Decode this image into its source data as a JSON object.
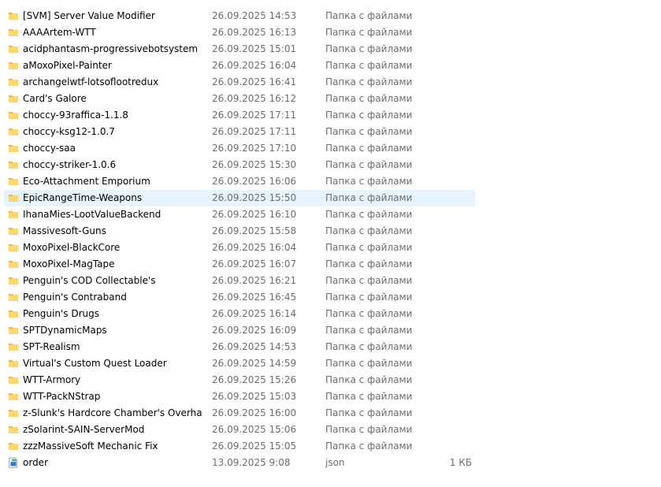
{
  "colors": {
    "selected_row_bg": "#e5f3ff",
    "secondary_text": "#6d6d6d",
    "folder_fill": "#ffd86b",
    "folder_dark": "#e8b13a"
  },
  "rows": [
    {
      "name": "[SVM] Server Value Modifier",
      "date": "26.09.2025 14:53",
      "type": "Папка с файлами",
      "size": "",
      "icon": "folder-icon"
    },
    {
      "name": "AAAArtem-WTT",
      "date": "26.09.2025 16:13",
      "type": "Папка с файлами",
      "size": "",
      "icon": "folder-icon"
    },
    {
      "name": "acidphantasm-progressivebotsystem",
      "date": "26.09.2025 15:01",
      "type": "Папка с файлами",
      "size": "",
      "icon": "folder-icon"
    },
    {
      "name": "aMoxoPixel-Painter",
      "date": "26.09.2025 16:04",
      "type": "Папка с файлами",
      "size": "",
      "icon": "folder-icon"
    },
    {
      "name": "archangelwtf-lotsoflootredux",
      "date": "26.09.2025 16:41",
      "type": "Папка с файлами",
      "size": "",
      "icon": "folder-icon"
    },
    {
      "name": "Card's Galore",
      "date": "26.09.2025 16:12",
      "type": "Папка с файлами",
      "size": "",
      "icon": "folder-icon"
    },
    {
      "name": "choccy-93raffica-1.1.8",
      "date": "26.09.2025 17:11",
      "type": "Папка с файлами",
      "size": "",
      "icon": "folder-icon"
    },
    {
      "name": "choccy-ksg12-1.0.7",
      "date": "26.09.2025 17:11",
      "type": "Папка с файлами",
      "size": "",
      "icon": "folder-icon"
    },
    {
      "name": "choccy-saa",
      "date": "26.09.2025 17:10",
      "type": "Папка с файлами",
      "size": "",
      "icon": "folder-icon"
    },
    {
      "name": "choccy-striker-1.0.6",
      "date": "26.09.2025 15:30",
      "type": "Папка с файлами",
      "size": "",
      "icon": "folder-icon"
    },
    {
      "name": "Eco-Attachment Emporium",
      "date": "26.09.2025 16:06",
      "type": "Папка с файлами",
      "size": "",
      "icon": "folder-icon"
    },
    {
      "name": "EpicRangeTime-Weapons",
      "date": "26.09.2025 15:50",
      "type": "Папка с файлами",
      "size": "",
      "icon": "folder-icon",
      "selected": true
    },
    {
      "name": "IhanaMies-LootValueBackend",
      "date": "26.09.2025 16:10",
      "type": "Папка с файлами",
      "size": "",
      "icon": "folder-icon"
    },
    {
      "name": "Massivesoft-Guns",
      "date": "26.09.2025 15:58",
      "type": "Папка с файлами",
      "size": "",
      "icon": "folder-icon"
    },
    {
      "name": "MoxoPixel-BlackCore",
      "date": "26.09.2025 16:04",
      "type": "Папка с файлами",
      "size": "",
      "icon": "folder-icon"
    },
    {
      "name": "MoxoPixel-MagTape",
      "date": "26.09.2025 16:07",
      "type": "Папка с файлами",
      "size": "",
      "icon": "folder-icon"
    },
    {
      "name": "Penguin's COD Collectable's",
      "date": "26.09.2025 16:21",
      "type": "Папка с файлами",
      "size": "",
      "icon": "folder-icon"
    },
    {
      "name": "Penguin's Contraband",
      "date": "26.09.2025 16:45",
      "type": "Папка с файлами",
      "size": "",
      "icon": "folder-icon"
    },
    {
      "name": "Penguin's Drugs",
      "date": "26.09.2025 16:14",
      "type": "Папка с файлами",
      "size": "",
      "icon": "folder-icon"
    },
    {
      "name": "SPTDynamicMaps",
      "date": "26.09.2025 16:09",
      "type": "Папка с файлами",
      "size": "",
      "icon": "folder-icon"
    },
    {
      "name": "SPT-Realism",
      "date": "26.09.2025 14:53",
      "type": "Папка с файлами",
      "size": "",
      "icon": "folder-icon"
    },
    {
      "name": "Virtual's Custom Quest Loader",
      "date": "26.09.2025 14:59",
      "type": "Папка с файлами",
      "size": "",
      "icon": "folder-icon"
    },
    {
      "name": "WTT-Armory",
      "date": "26.09.2025 15:26",
      "type": "Папка с файлами",
      "size": "",
      "icon": "folder-icon"
    },
    {
      "name": "WTT-PackNStrap",
      "date": "26.09.2025 15:03",
      "type": "Папка с файлами",
      "size": "",
      "icon": "folder-icon"
    },
    {
      "name": "z-Slunk's Hardcore Chamber's Overhaul (...",
      "date": "26.09.2025 16:00",
      "type": "Папка с файлами",
      "size": "",
      "icon": "folder-icon"
    },
    {
      "name": "zSolarint-SAIN-ServerMod",
      "date": "26.09.2025 15:06",
      "type": "Папка с файлами",
      "size": "",
      "icon": "folder-icon"
    },
    {
      "name": "zzzMassiveSoft Mechanic Fix",
      "date": "26.09.2025 15:05",
      "type": "Папка с файлами",
      "size": "",
      "icon": "folder-icon"
    },
    {
      "name": "order",
      "date": "13.09.2025 9:08",
      "type": "json",
      "size": "1 КБ",
      "icon": "json-file-icon"
    }
  ]
}
